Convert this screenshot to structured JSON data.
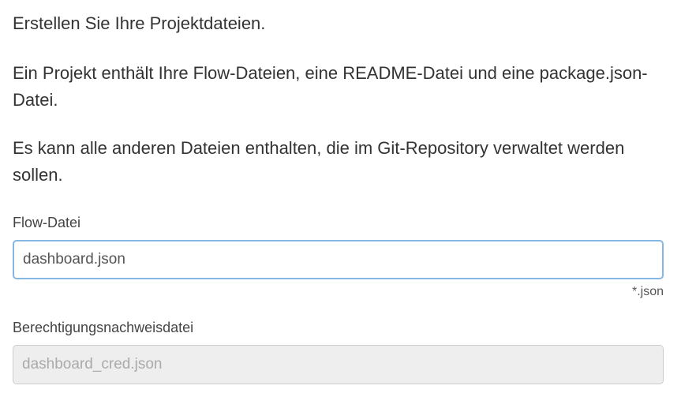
{
  "heading": "Erstellen Sie Ihre Projektdateien.",
  "paragraphs": {
    "p1": "Ein Projekt enthält Ihre Flow-Dateien, eine README-Datei und eine package.json-Datei.",
    "p2": "Es kann alle anderen Dateien enthalten, die im Git-Repository verwaltet werden sollen."
  },
  "flow_file": {
    "label": "Flow-Datei",
    "value": "dashboard.json",
    "hint": "*.json"
  },
  "credentials_file": {
    "label": "Berechtigungsnachweisdatei",
    "value": "dashboard_cred.json"
  },
  "colors": {
    "text": "#333333",
    "focus_border": "#85b7e3",
    "disabled_background": "#eeeeee"
  }
}
